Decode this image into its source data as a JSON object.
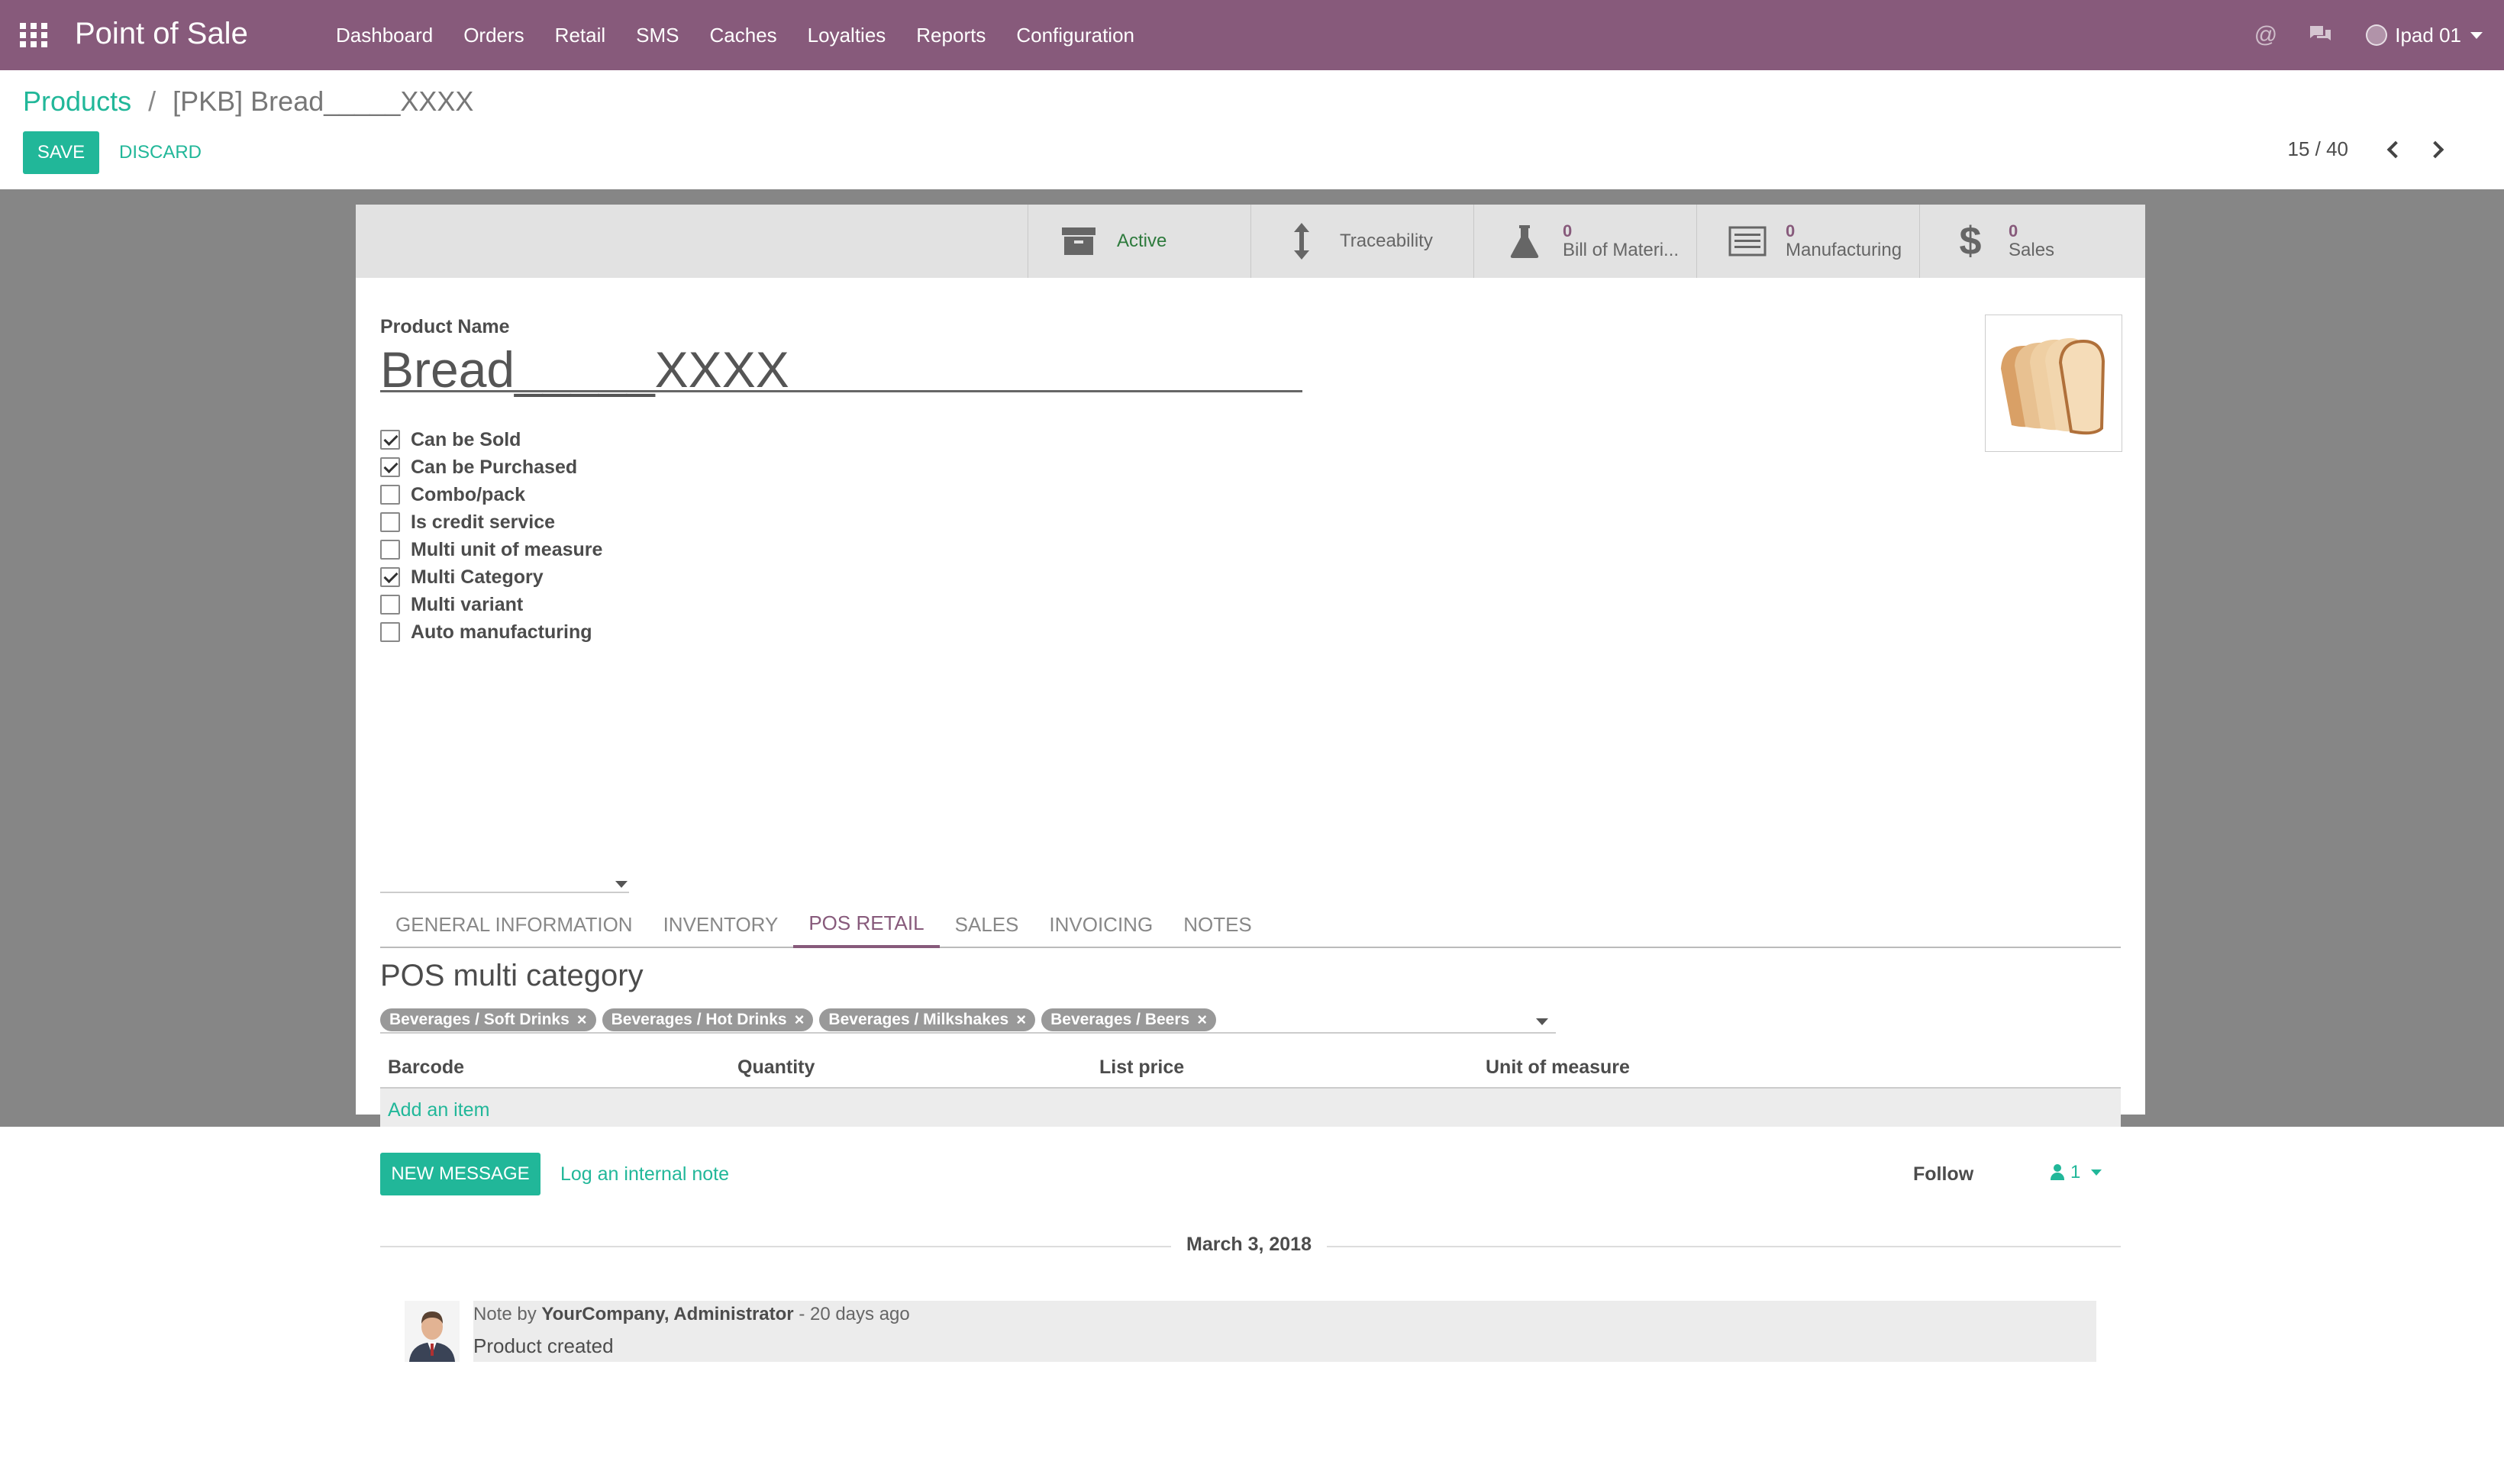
{
  "navbar": {
    "app_title": "Point of Sale",
    "menu": [
      "Dashboard",
      "Orders",
      "Retail",
      "SMS",
      "Caches",
      "Loyalties",
      "Reports",
      "Configuration"
    ],
    "user": "Ipad 01",
    "icons": [
      "apps-grid-icon",
      "at-sign-icon",
      "chat-bubbles-icon"
    ]
  },
  "breadcrumb": {
    "parent": "Products",
    "separator": "/",
    "current": "[PKB] Bread_____XXXX"
  },
  "actions": {
    "save": "SAVE",
    "discard": "DISCARD"
  },
  "pager": {
    "value": "15 / 40"
  },
  "smart_buttons": [
    {
      "count": "",
      "label": "Active",
      "icon": "archive-icon"
    },
    {
      "count": "",
      "label": "Traceability",
      "icon": "vertical-arrows-icon"
    },
    {
      "count": "0",
      "label": "Bill of Materi...",
      "icon": "flask-icon"
    },
    {
      "count": "0",
      "label": "Manufacturing",
      "icon": "list-icon"
    },
    {
      "count": "0",
      "label": "Sales",
      "icon": "dollar-icon"
    }
  ],
  "form": {
    "product_name_label": "Product Name",
    "product_name": "Bread_____XXXX",
    "checkboxes": [
      {
        "label": "Can be Sold",
        "checked": true
      },
      {
        "label": "Can be Purchased",
        "checked": true
      },
      {
        "label": "Combo/pack",
        "checked": false
      },
      {
        "label": "Is credit service",
        "checked": false
      },
      {
        "label": "Multi unit of measure",
        "checked": false
      },
      {
        "label": "Multi Category",
        "checked": true
      },
      {
        "label": "Multi variant",
        "checked": false
      },
      {
        "label": "Auto manufacturing",
        "checked": false
      }
    ]
  },
  "tabs": [
    "GENERAL INFORMATION",
    "INVENTORY",
    "POS RETAIL",
    "SALES",
    "INVOICING",
    "NOTES"
  ],
  "selected_tab": "POS RETAIL",
  "pos": {
    "section_title": "POS multi category",
    "tags": [
      "Beverages / Soft Drinks",
      "Beverages / Hot Drinks",
      "Beverages / Milkshakes",
      "Beverages / Beers"
    ],
    "columns": [
      "Barcode",
      "Quantity",
      "List price",
      "Unit of measure"
    ],
    "add_item": "Add an item"
  },
  "chatter": {
    "new_message": "NEW MESSAGE",
    "log_note": "Log an internal note",
    "follow": "Follow",
    "followers_count": "1",
    "date": "March 3, 2018",
    "message": {
      "prefix": "Note by",
      "author": "YourCompany, Administrator",
      "time": "- 20 days ago",
      "body": "Product created"
    }
  },
  "colors": {
    "brand": "#875a7b",
    "accent": "#21b799"
  }
}
